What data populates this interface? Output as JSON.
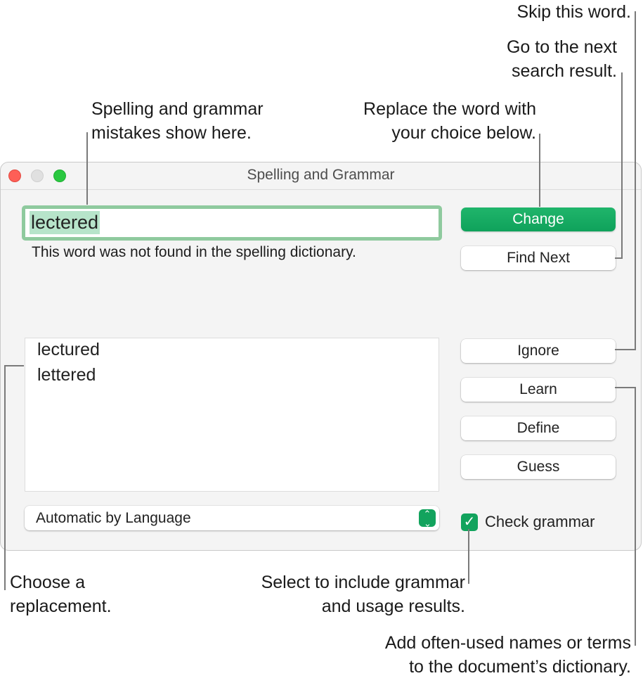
{
  "callouts": {
    "skip_word": "Skip this word.",
    "find_next_line1": "Go to the next",
    "find_next_line2": "search result.",
    "mistakes_line1": "Spelling and grammar",
    "mistakes_line2": "mistakes show here.",
    "replace_line1": "Replace the word with",
    "replace_line2": "your choice below.",
    "choose_line1": "Choose a",
    "choose_line2": "replacement.",
    "grammar_line1": "Select to include grammar",
    "grammar_line2": "and usage results.",
    "learn_line1": "Add often-used names or terms",
    "learn_line2": "to the document’s dictionary."
  },
  "window": {
    "title": "Spelling and Grammar",
    "misspelled_word": "lectered",
    "status_message": "This word was not found in the spelling dictionary.",
    "buttons": {
      "change": "Change",
      "find_next": "Find Next",
      "ignore": "Ignore",
      "learn": "Learn",
      "define": "Define",
      "guess": "Guess"
    },
    "suggestions": [
      "lectured",
      "lettered"
    ],
    "language": "Automatic by Language",
    "check_grammar": {
      "label": "Check grammar",
      "checked": true
    },
    "accent_color": "#12a35d"
  }
}
